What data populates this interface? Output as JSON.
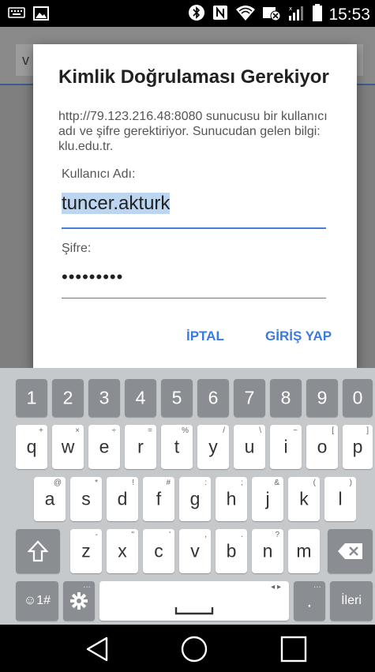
{
  "status_bar": {
    "time": "15:53"
  },
  "app": {
    "url_text": "v"
  },
  "dialog": {
    "title": "Kimlik Doğrulaması Gerekiyor",
    "message": "http://79.123.216.48:8080 sunucusu bir kullanıcı adı ve şifre gerektiriyor. Sunucudan gelen bilgi: klu.edu.tr.",
    "username_label": "Kullanıcı Adı:",
    "username_value": "tuncer.akturk",
    "password_label": "Şifre:",
    "password_value": "•••••••••",
    "cancel_label": "İPTAL",
    "login_label": "GİRİŞ YAP"
  },
  "keyboard": {
    "number_row": [
      "1",
      "2",
      "3",
      "4",
      "5",
      "6",
      "7",
      "8",
      "9",
      "0"
    ],
    "row1": [
      "q",
      "w",
      "e",
      "r",
      "t",
      "y",
      "u",
      "i",
      "o",
      "p"
    ],
    "row1_hints": [
      "+",
      "×",
      "÷",
      "=",
      "%",
      "/",
      "\\",
      "~",
      "[",
      "]"
    ],
    "row2": [
      "a",
      "s",
      "d",
      "f",
      "g",
      "h",
      "j",
      "k",
      "l"
    ],
    "row2_hints": [
      "@",
      "*",
      "!",
      "#",
      ":",
      ";",
      "&",
      "(",
      ")"
    ],
    "row3": [
      "z",
      "x",
      "c",
      "v",
      "b",
      "n",
      "m"
    ],
    "row3_hints": [
      "-",
      "\"",
      "'",
      ",",
      ".",
      "?",
      ""
    ],
    "symbols_label": "☺1#",
    "period_label": ".",
    "next_label": "İleri"
  },
  "icons": {
    "shift": "shift-icon",
    "backspace": "backspace-icon",
    "settings": "gear-icon",
    "space": "space-icon",
    "back": "back-icon",
    "home": "home-icon",
    "recents": "recents-icon"
  },
  "colors": {
    "accent": "#3b7be0",
    "keyboard_bg": "#c6c9cc",
    "number_key": "#8a8e92"
  }
}
